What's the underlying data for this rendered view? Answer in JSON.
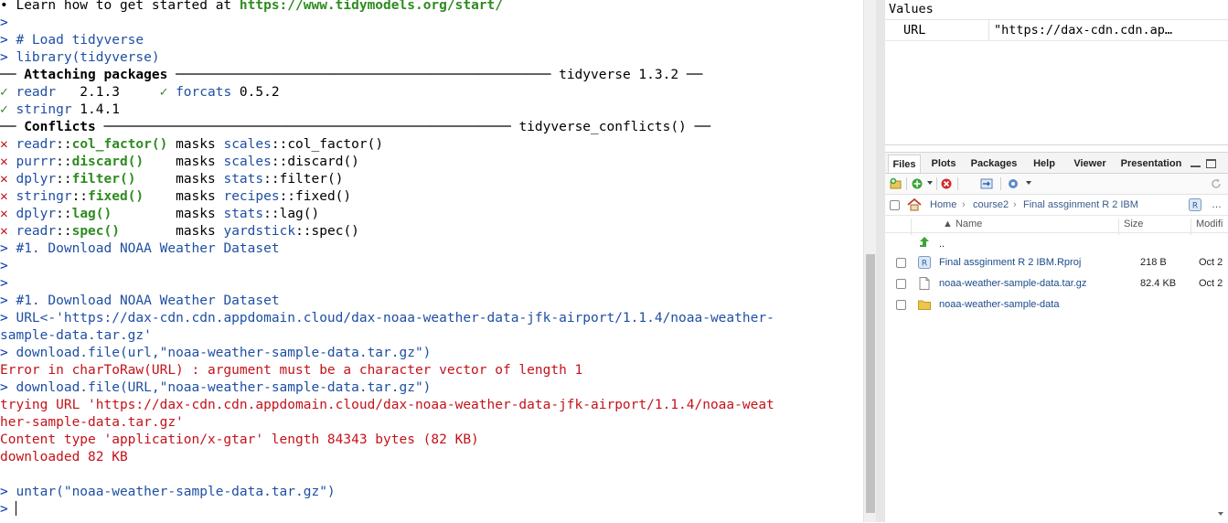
{
  "console": {
    "lines": [
      [
        {
          "t": "• Learn how to get started at ",
          "c": "blk"
        },
        {
          "t": "https://www.tidymodels.org/start/",
          "c": "grn"
        }
      ],
      [
        {
          "t": ">",
          "c": "prompt"
        }
      ],
      [
        {
          "t": "> ",
          "c": "prompt"
        },
        {
          "t": "# Load tidyverse",
          "c": "blue"
        }
      ],
      [
        {
          "t": "> ",
          "c": "prompt"
        },
        {
          "t": "library(tidyverse)",
          "c": "blue"
        }
      ],
      [
        {
          "t": "── ",
          "c": "blk"
        },
        {
          "t": "Attaching packages",
          "c": "bold"
        },
        {
          "t": " ─────────────────────────────────────────────── tidyverse 1.3.2 ──",
          "c": "blk"
        }
      ],
      [
        {
          "t": "✓ ",
          "c": "grn"
        },
        {
          "t": "readr  ",
          "c": "blue"
        },
        {
          "t": " 2.1.3     ",
          "c": "blk"
        },
        {
          "t": "✓ ",
          "c": "grn"
        },
        {
          "t": "forcats",
          "c": "blue"
        },
        {
          "t": " 0.5.2",
          "c": "blk"
        }
      ],
      [
        {
          "t": "✓ ",
          "c": "grn"
        },
        {
          "t": "stringr",
          "c": "blue"
        },
        {
          "t": " 1.4.1",
          "c": "blk"
        }
      ],
      [
        {
          "t": "── ",
          "c": "blk"
        },
        {
          "t": "Conflicts",
          "c": "bold"
        },
        {
          "t": " ─────────────────────────────────────────────────── tidyverse_conflicts() ──",
          "c": "blk"
        }
      ],
      [
        {
          "t": "✕ ",
          "c": "red"
        },
        {
          "t": "readr",
          "c": "blue"
        },
        {
          "t": "::",
          "c": "blk"
        },
        {
          "t": "col_factor()",
          "c": "grn"
        },
        {
          "t": " masks ",
          "c": "blk"
        },
        {
          "t": "scales",
          "c": "blue"
        },
        {
          "t": "::col_factor()",
          "c": "blk"
        }
      ],
      [
        {
          "t": "✕ ",
          "c": "red"
        },
        {
          "t": "purrr",
          "c": "blue"
        },
        {
          "t": "::",
          "c": "blk"
        },
        {
          "t": "discard()",
          "c": "grn"
        },
        {
          "t": "    masks ",
          "c": "blk"
        },
        {
          "t": "scales",
          "c": "blue"
        },
        {
          "t": "::discard()",
          "c": "blk"
        }
      ],
      [
        {
          "t": "✕ ",
          "c": "red"
        },
        {
          "t": "dplyr",
          "c": "blue"
        },
        {
          "t": "::",
          "c": "blk"
        },
        {
          "t": "filter()",
          "c": "grn"
        },
        {
          "t": "     masks ",
          "c": "blk"
        },
        {
          "t": "stats",
          "c": "blue"
        },
        {
          "t": "::filter()",
          "c": "blk"
        }
      ],
      [
        {
          "t": "✕ ",
          "c": "red"
        },
        {
          "t": "stringr",
          "c": "blue"
        },
        {
          "t": "::",
          "c": "blk"
        },
        {
          "t": "fixed()",
          "c": "grn"
        },
        {
          "t": "    masks ",
          "c": "blk"
        },
        {
          "t": "recipes",
          "c": "blue"
        },
        {
          "t": "::fixed()",
          "c": "blk"
        }
      ],
      [
        {
          "t": "✕ ",
          "c": "red"
        },
        {
          "t": "dplyr",
          "c": "blue"
        },
        {
          "t": "::",
          "c": "blk"
        },
        {
          "t": "lag()",
          "c": "grn"
        },
        {
          "t": "        masks ",
          "c": "blk"
        },
        {
          "t": "stats",
          "c": "blue"
        },
        {
          "t": "::lag()",
          "c": "blk"
        }
      ],
      [
        {
          "t": "✕ ",
          "c": "red"
        },
        {
          "t": "readr",
          "c": "blue"
        },
        {
          "t": "::",
          "c": "blk"
        },
        {
          "t": "spec()",
          "c": "grn"
        },
        {
          "t": "       masks ",
          "c": "blk"
        },
        {
          "t": "yardstick",
          "c": "blue"
        },
        {
          "t": "::spec()",
          "c": "blk"
        }
      ],
      [
        {
          "t": "> ",
          "c": "prompt"
        },
        {
          "t": "#1. Download NOAA Weather Dataset",
          "c": "blue"
        }
      ],
      [
        {
          "t": ">",
          "c": "prompt"
        }
      ],
      [
        {
          "t": ">",
          "c": "prompt"
        }
      ],
      [
        {
          "t": "> ",
          "c": "prompt"
        },
        {
          "t": "#1. Download NOAA Weather Dataset",
          "c": "blue"
        }
      ],
      [
        {
          "t": "> ",
          "c": "prompt"
        },
        {
          "t": "URL<-'https://dax-cdn.cdn.appdomain.cloud/dax-noaa-weather-data-jfk-airport/1.1.4/noaa-weather-",
          "c": "blue"
        }
      ],
      [
        {
          "t": "sample-data.tar.gz'",
          "c": "blue"
        }
      ],
      [
        {
          "t": "> ",
          "c": "prompt"
        },
        {
          "t": "download.file(url,\"noaa-weather-sample-data.tar.gz\")",
          "c": "blue"
        }
      ],
      [
        {
          "t": "Error in charToRaw(URL) : argument must be a character vector of length 1",
          "c": "err"
        }
      ],
      [
        {
          "t": "> ",
          "c": "prompt"
        },
        {
          "t": "download.file(URL,\"noaa-weather-sample-data.tar.gz\")",
          "c": "blue"
        }
      ],
      [
        {
          "t": "trying URL 'https://dax-cdn.cdn.appdomain.cloud/dax-noaa-weather-data-jfk-airport/1.1.4/noaa-weat",
          "c": "err"
        }
      ],
      [
        {
          "t": "her-sample-data.tar.gz'",
          "c": "err"
        }
      ],
      [
        {
          "t": "Content type 'application/x-gtar' length 84343 bytes (82 KB)",
          "c": "err"
        }
      ],
      [
        {
          "t": "downloaded 82 KB",
          "c": "err"
        }
      ],
      [
        {
          "t": "",
          "c": "blk"
        }
      ],
      [
        {
          "t": "> ",
          "c": "prompt"
        },
        {
          "t": "untar(\"noaa-weather-sample-data.tar.gz\")",
          "c": "blue"
        }
      ],
      [
        {
          "t": "> ",
          "c": "prompt"
        }
      ]
    ]
  },
  "environment": {
    "header": "Values",
    "rows": [
      {
        "name": "URL",
        "value": "\"https://dax-cdn.cdn.ap…"
      }
    ]
  },
  "files_pane": {
    "tabs": [
      "Files",
      "Plots",
      "Packages",
      "Help",
      "Viewer",
      "Presentation"
    ],
    "active_tab": "Files",
    "breadcrumb": [
      "Home",
      "course2",
      "Final assginment R 2 IBM"
    ],
    "more": "…",
    "columns": {
      "name": "▲ Name",
      "size": "Size",
      "modified": "Modifi"
    },
    "up_label": "..",
    "files": [
      {
        "name": "Final assginment R 2 IBM.Rproj",
        "size": "218 B",
        "modified": "Oct 2",
        "icon": "rproj"
      },
      {
        "name": "noaa-weather-sample-data.tar.gz",
        "size": "82.4 KB",
        "modified": "Oct 2",
        "icon": "file"
      },
      {
        "name": "noaa-weather-sample-data",
        "size": "",
        "modified": "",
        "icon": "folder"
      }
    ]
  },
  "colors": {
    "prompt": "#0033b3",
    "code": "#1f4fa3",
    "error": "#c4121a",
    "check": "#2e8b20"
  }
}
